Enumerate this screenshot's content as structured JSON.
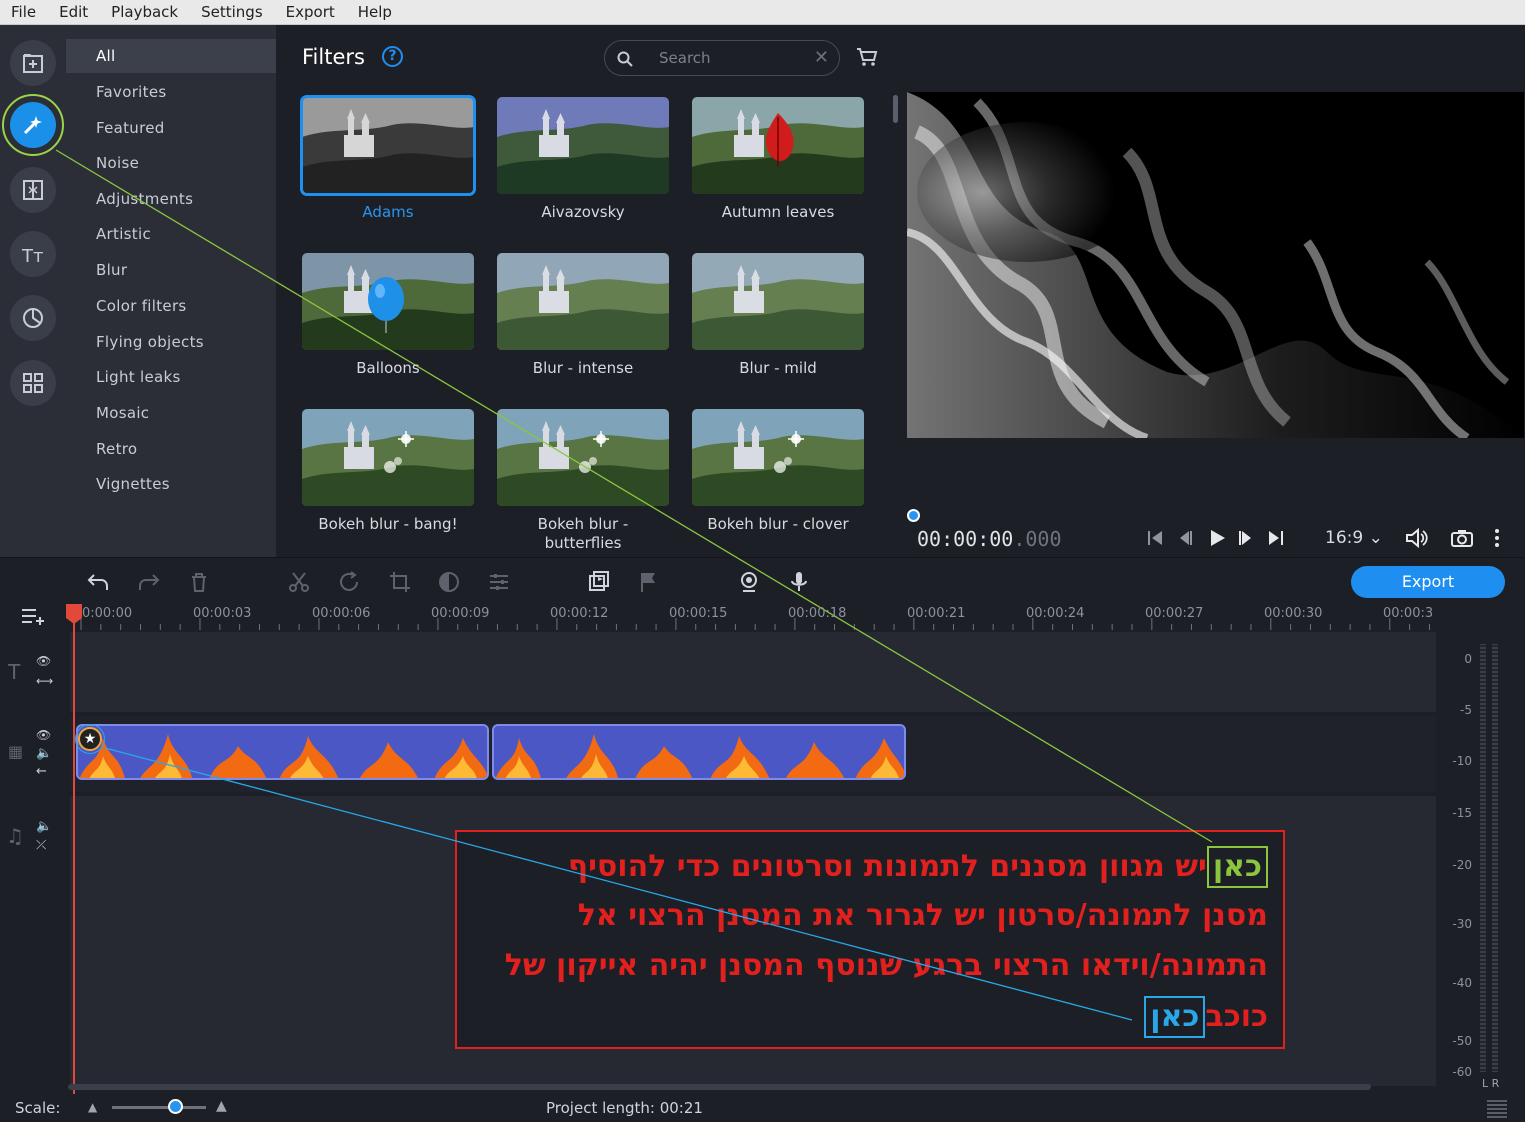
{
  "menu": [
    "File",
    "Edit",
    "Playback",
    "Settings",
    "Export",
    "Help"
  ],
  "tools": [
    {
      "name": "import-icon"
    },
    {
      "name": "filters-wand-icon",
      "active": true
    },
    {
      "name": "transitions-icon"
    },
    {
      "name": "titles-icon"
    },
    {
      "name": "stickers-icon"
    },
    {
      "name": "more-tools-icon"
    }
  ],
  "categories": [
    "All",
    "Favorites",
    "Featured",
    "Noise",
    "Adjustments",
    "Artistic",
    "Blur",
    "Color filters",
    "Flying objects",
    "Light leaks",
    "Mosaic",
    "Retro",
    "Vignettes"
  ],
  "filters_panel": {
    "title": "Filters",
    "help": "?",
    "search_placeholder": "Search",
    "items": [
      {
        "label": "Adams",
        "selected": true
      },
      {
        "label": "Aivazovsky"
      },
      {
        "label": "Autumn leaves"
      },
      {
        "label": "Balloons"
      },
      {
        "label": "Blur - intense"
      },
      {
        "label": "Blur - mild"
      },
      {
        "label": "Bokeh blur - bang!"
      },
      {
        "label": "Bokeh blur -\nbutterflies"
      },
      {
        "label": "Bokeh blur - clover"
      }
    ]
  },
  "player": {
    "timecode": "00:00:00",
    "timecode_ms": ".000",
    "aspect": "16:9"
  },
  "toolbar": {
    "export_label": "Export"
  },
  "ruler": [
    "0:00:00",
    "00:00:03",
    "00:00:06",
    "00:00:09",
    "00:00:12",
    "00:00:15",
    "00:00:18",
    "00:00:21",
    "00:00:24",
    "00:00:27",
    "00:00:30",
    "00:00:3"
  ],
  "meter_labels": [
    "0",
    "-5",
    "-10",
    "-15",
    "-20",
    "-30",
    "-40",
    "-50",
    "-60"
  ],
  "meter_lr": "L R",
  "status": {
    "scale_label": "Scale:",
    "project_length": "Project length:  00:21"
  },
  "annotation": {
    "line1_highlight": "כאן",
    "line1_rest": "יש מגוון מסננים לתמונות וסרטונים כדי להוסיף",
    "line2": "מסנן לתמונה/סרטון יש לגרור את המסנן הרצוי אל",
    "line3": "התמונה/וידאו הרצוי ברגע שנוסף המסנן יהיה אייקון של",
    "line4_rest": "כוכב",
    "line4_highlight": "כאן"
  },
  "colors": {
    "accent": "#1e8ff0",
    "annotation_red": "#e2211f",
    "annotation_green": "#8cc63f",
    "annotation_blue": "#2aa7e8",
    "playhead": "#e3493a"
  }
}
